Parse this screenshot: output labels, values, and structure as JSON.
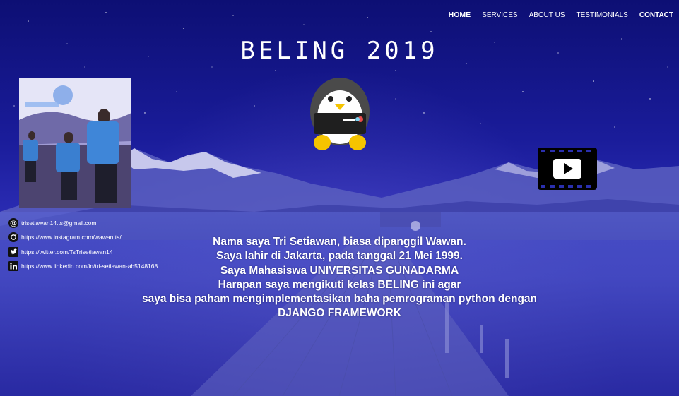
{
  "nav": {
    "items": [
      {
        "label": "HOME"
      },
      {
        "label": "SERVICES"
      },
      {
        "label": "ABOUT US"
      },
      {
        "label": "TESTIMONIALS"
      },
      {
        "label": "CONTACT"
      }
    ]
  },
  "header": {
    "title": "BELING 2019"
  },
  "contacts": [
    {
      "icon": "email-icon",
      "text": "trisetiawan14.ts@gmail.com"
    },
    {
      "icon": "instagram-icon",
      "text": "https://www.instagram.com/wawan.ts/"
    },
    {
      "icon": "twitter-icon",
      "text": "https://twitter.com/TsTrisetiawan14"
    },
    {
      "icon": "linkedin-icon",
      "text": "https://www.linkedin.com/in/tri-setiawan-ab5148168"
    }
  ],
  "bio": {
    "lines": [
      "Nama saya Tri Setiawan, biasa dipanggil Wawan.",
      "Saya lahir di Jakarta, pada tanggal 21 Mei 1999.",
      "Saya Mahasiswa UNIVERSITAS GUNADARMA",
      "Harapan saya mengikuti kelas BELING ini agar",
      "saya bisa paham mengimplementasikan baha pemrograman python dengan",
      "DJANGO FRAMEWORK"
    ]
  },
  "colors": {
    "background": "#1a1fa8",
    "text": "#ffffff",
    "penguin_belly": "#ffffff",
    "penguin_feet": "#f5c400"
  }
}
